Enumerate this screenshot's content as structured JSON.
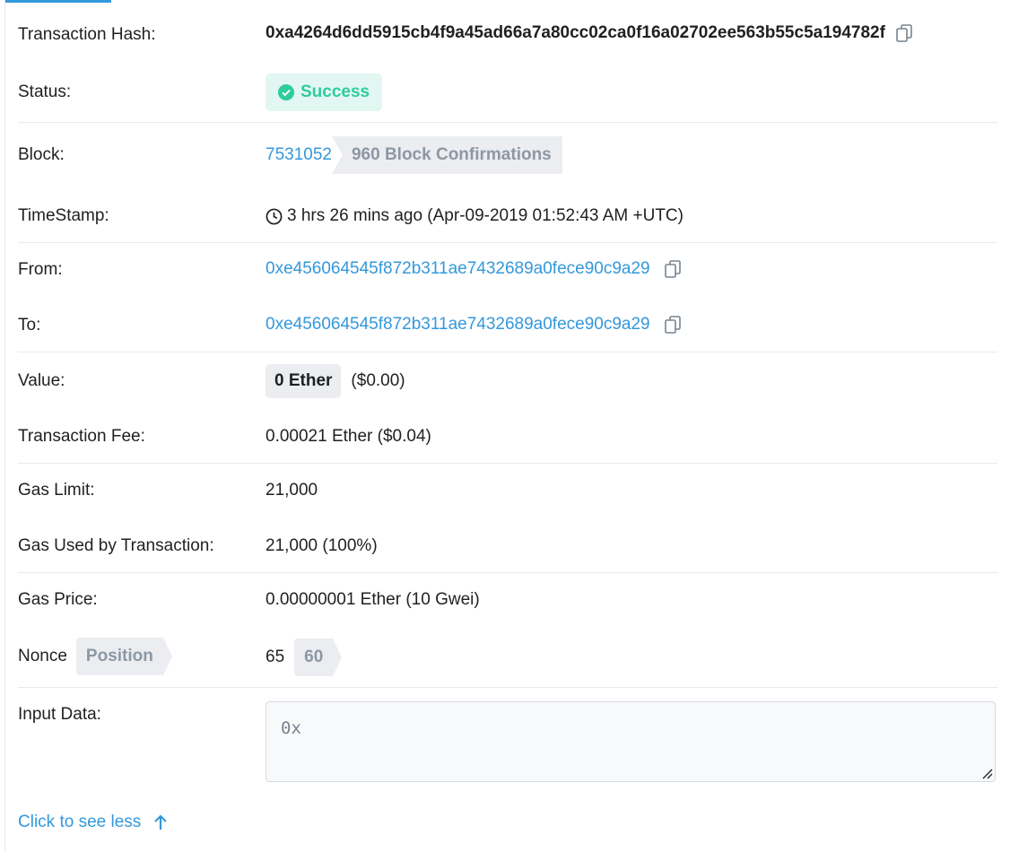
{
  "labels": {
    "tx_hash": "Transaction Hash:",
    "status": "Status:",
    "block": "Block:",
    "timestamp": "TimeStamp:",
    "from": "From:",
    "to": "To:",
    "value": "Value:",
    "fee": "Transaction Fee:",
    "gas_limit": "Gas Limit:",
    "gas_used": "Gas Used by Transaction:",
    "gas_price": "Gas Price:",
    "nonce": "Nonce",
    "nonce_position": "Position",
    "input_data": "Input Data:"
  },
  "values": {
    "tx_hash": "0xa4264d6dd5915cb4f9a45ad66a7a80cc02ca0f16a02702ee563b55c5a194782f",
    "status": "Success",
    "block_number": "7531052",
    "block_confirmations": "960 Block Confirmations",
    "timestamp": "3 hrs 26 mins ago (Apr-09-2019 01:52:43 AM +UTC)",
    "from": "0xe456064545f872b311ae7432689a0fece90c9a29",
    "to": "0xe456064545f872b311ae7432689a0fece90c9a29",
    "value_amount": "0 Ether",
    "value_usd": "($0.00)",
    "fee": "0.00021 Ether ($0.04)",
    "gas_limit": "21,000",
    "gas_used": "21,000 (100%)",
    "gas_price": "0.00000001 Ether (10 Gwei)",
    "nonce": "65",
    "nonce_position": "60",
    "input_data": "0x"
  },
  "footer": {
    "see_less": "Click to see less"
  },
  "icons": {
    "copy": "copy-icon",
    "check": "check-circle-icon",
    "clock": "clock-icon",
    "arrow": "arrow-up-icon"
  },
  "colors": {
    "link": "#3498db",
    "success_text": "#2ecc9f",
    "success_bg": "#e2f7f1",
    "tag_bg": "#ecedf1",
    "tag_text": "#8c98a4",
    "divider": "#e7eaf3"
  }
}
